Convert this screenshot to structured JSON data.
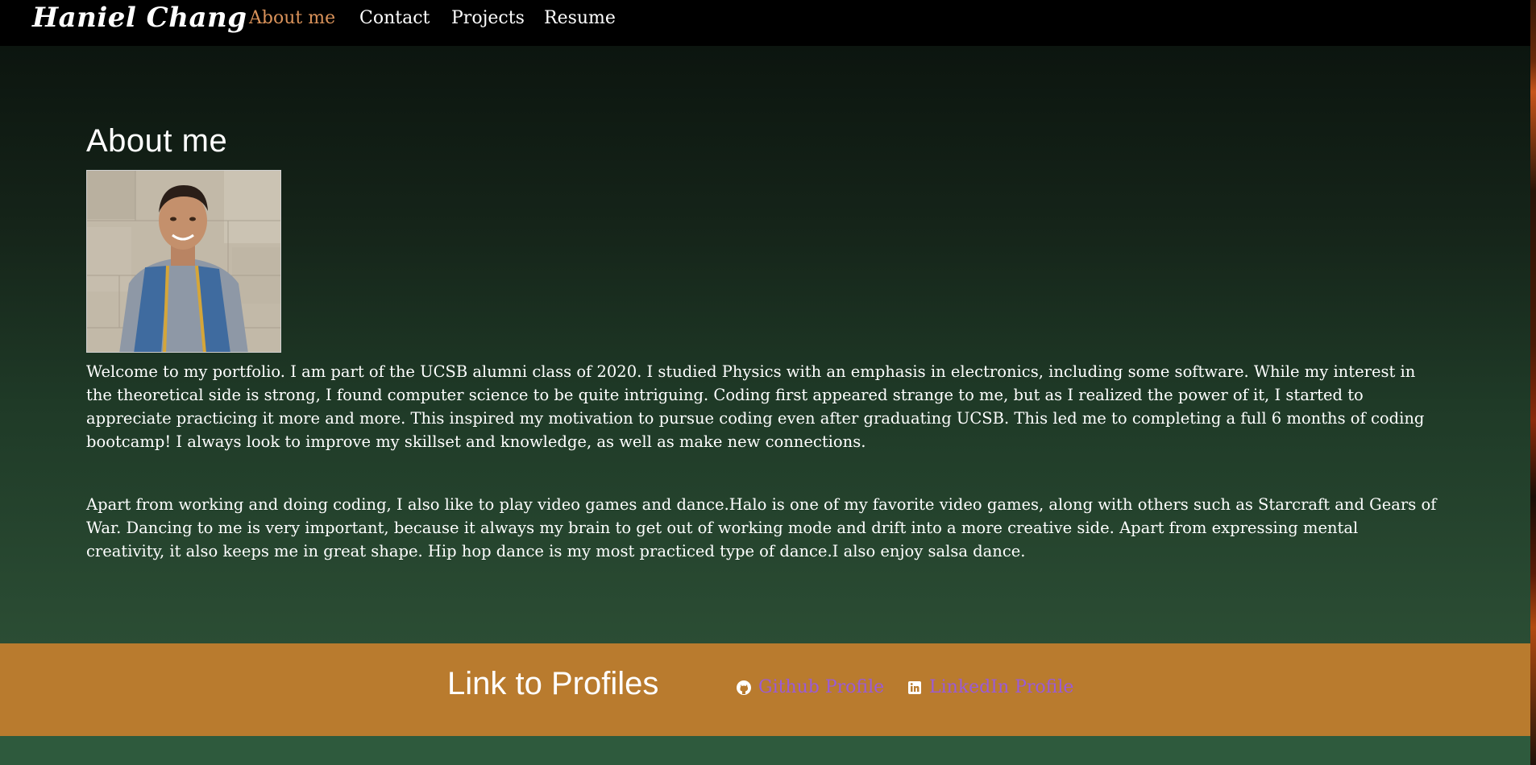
{
  "nav": {
    "brand": "Haniel Chang",
    "links": [
      {
        "label": "About me",
        "active": true
      },
      {
        "label": "Contact",
        "active": false
      },
      {
        "label": "Projects",
        "active": false
      },
      {
        "label": "Resume",
        "active": false
      }
    ]
  },
  "about": {
    "title": "About me",
    "photo_icon": "profile-photo",
    "paragraphs": [
      "Welcome to my portfolio. I am part of the UCSB alumni class of 2020. I studied Physics with an emphasis in electronics, including some software. While my interest in the theoretical side is strong, I found computer science to be quite intriguing. Coding first appeared strange to me, but as I realized the power of it, I started to appreciate practicing it more and more. This inspired my motivation to pursue coding even after graduating UCSB. This led me to completing a full 6 months of coding bootcamp! I always look to improve my skillset and knowledge, as well as make new connections.",
      "Apart from working and doing coding, I also like to play video games and dance.Halo is one of my favorite video games, along with others such as Starcraft and Gears of War. Dancing to me is very important, because it always my brain to get out of working mode and drift into a more creative side. Apart from expressing mental creativity, it also keeps me in great shape. Hip hop dance is my most practiced type of dance.I also enjoy salsa dance."
    ]
  },
  "footer": {
    "title": "Link to Profiles",
    "links": [
      {
        "label": "Github Profile",
        "icon": "github-icon"
      },
      {
        "label": "LinkedIn Profile",
        "icon": "linkedin-icon"
      }
    ]
  },
  "colors": {
    "nav_bg": "#000000",
    "active_link": "#d9925a",
    "footer_bg": "#b97b2e",
    "profile_link": "#9b5bd6",
    "page_green": "#2e5a3d"
  }
}
